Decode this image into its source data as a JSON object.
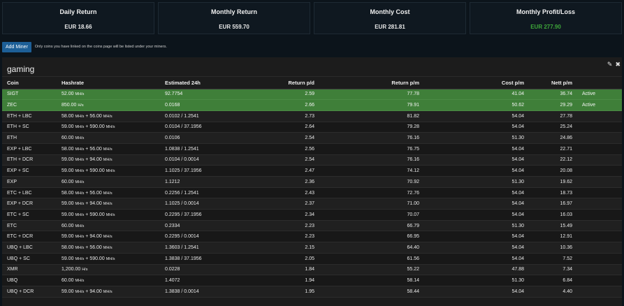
{
  "stats": [
    {
      "title": "Daily Return",
      "value": "EUR 18.66"
    },
    {
      "title": "Monthly Return",
      "value": "EUR 559.70"
    },
    {
      "title": "Monthly Cost",
      "value": "EUR 281.81"
    },
    {
      "title": "Monthly Profit/Loss",
      "value": "EUR 277.90"
    }
  ],
  "colors": {
    "positive": "#3ea83a",
    "active_row": "#3f7f39",
    "button": "#1d5f97"
  },
  "add_miner": {
    "label": "Add Miner",
    "note": "Only coins you have linked on the coins page will be listed under your miners."
  },
  "panel": {
    "title": "gaming",
    "edit_icon": "pencil-icon",
    "close_icon": "close-icon"
  },
  "table": {
    "headers": [
      "Coin",
      "Hashrate",
      "Estimated 24h",
      "Return p/d",
      "Return p/m",
      "Cost p/m",
      "Nett p/m",
      ""
    ],
    "rows": [
      {
        "coin": "SIGT",
        "hash": "52.00",
        "unit": "MH/s",
        "hash2": "",
        "unit2": "",
        "est": "92.7754",
        "rpd": "2.59",
        "rpm": "77.78",
        "cost": "41.04",
        "nett": "36.74",
        "status": "Active"
      },
      {
        "coin": "ZEC",
        "hash": "850.00",
        "unit": "H/s",
        "hash2": "",
        "unit2": "",
        "est": "0.0168",
        "rpd": "2.66",
        "rpm": "79.91",
        "cost": "50.62",
        "nett": "29.29",
        "status": "Active"
      },
      {
        "coin": "ETH + LBC",
        "hash": "58.00",
        "unit": "MH/s",
        "hash2": "56.00",
        "unit2": "MH/s",
        "est": "0.0102 / 1.2541",
        "rpd": "2.73",
        "rpm": "81.82",
        "cost": "54.04",
        "nett": "27.78",
        "status": ""
      },
      {
        "coin": "ETH + SC",
        "hash": "59.00",
        "unit": "MH/s",
        "hash2": "590.00",
        "unit2": "MH/s",
        "est": "0.0104 / 37.1956",
        "rpd": "2.64",
        "rpm": "79.28",
        "cost": "54.04",
        "nett": "25.24",
        "status": ""
      },
      {
        "coin": "ETH",
        "hash": "60.00",
        "unit": "MH/s",
        "hash2": "",
        "unit2": "",
        "est": "0.0106",
        "rpd": "2.54",
        "rpm": "76.16",
        "cost": "51.30",
        "nett": "24.86",
        "status": ""
      },
      {
        "coin": "EXP + LBC",
        "hash": "58.00",
        "unit": "MH/s",
        "hash2": "56.00",
        "unit2": "MH/s",
        "est": "1.0838 / 1.2541",
        "rpd": "2.56",
        "rpm": "76.75",
        "cost": "54.04",
        "nett": "22.71",
        "status": ""
      },
      {
        "coin": "ETH + DCR",
        "hash": "59.00",
        "unit": "MH/s",
        "hash2": "94.00",
        "unit2": "MH/s",
        "est": "0.0104 / 0.0014",
        "rpd": "2.54",
        "rpm": "76.16",
        "cost": "54.04",
        "nett": "22.12",
        "status": ""
      },
      {
        "coin": "EXP + SC",
        "hash": "59.00",
        "unit": "MH/s",
        "hash2": "590.00",
        "unit2": "MH/s",
        "est": "1.1025 / 37.1956",
        "rpd": "2.47",
        "rpm": "74.12",
        "cost": "54.04",
        "nett": "20.08",
        "status": ""
      },
      {
        "coin": "EXP",
        "hash": "60.00",
        "unit": "MH/s",
        "hash2": "",
        "unit2": "",
        "est": "1.1212",
        "rpd": "2.36",
        "rpm": "70.92",
        "cost": "51.30",
        "nett": "19.62",
        "status": ""
      },
      {
        "coin": "ETC + LBC",
        "hash": "58.00",
        "unit": "MH/s",
        "hash2": "56.00",
        "unit2": "MH/s",
        "est": "0.2256 / 1.2541",
        "rpd": "2.43",
        "rpm": "72.76",
        "cost": "54.04",
        "nett": "18.73",
        "status": ""
      },
      {
        "coin": "EXP + DCR",
        "hash": "59.00",
        "unit": "MH/s",
        "hash2": "94.00",
        "unit2": "MH/s",
        "est": "1.1025 / 0.0014",
        "rpd": "2.37",
        "rpm": "71.00",
        "cost": "54.04",
        "nett": "16.97",
        "status": ""
      },
      {
        "coin": "ETC + SC",
        "hash": "59.00",
        "unit": "MH/s",
        "hash2": "590.00",
        "unit2": "MH/s",
        "est": "0.2295 / 37.1956",
        "rpd": "2.34",
        "rpm": "70.07",
        "cost": "54.04",
        "nett": "16.03",
        "status": ""
      },
      {
        "coin": "ETC",
        "hash": "60.00",
        "unit": "MH/s",
        "hash2": "",
        "unit2": "",
        "est": "0.2334",
        "rpd": "2.23",
        "rpm": "66.79",
        "cost": "51.30",
        "nett": "15.49",
        "status": ""
      },
      {
        "coin": "ETC + DCR",
        "hash": "59.00",
        "unit": "MH/s",
        "hash2": "94.00",
        "unit2": "MH/s",
        "est": "0.2295 / 0.0014",
        "rpd": "2.23",
        "rpm": "66.95",
        "cost": "54.04",
        "nett": "12.91",
        "status": ""
      },
      {
        "coin": "UBQ + LBC",
        "hash": "58.00",
        "unit": "MH/s",
        "hash2": "56.00",
        "unit2": "MH/s",
        "est": "1.3603 / 1.2541",
        "rpd": "2.15",
        "rpm": "64.40",
        "cost": "54.04",
        "nett": "10.36",
        "status": ""
      },
      {
        "coin": "UBQ + SC",
        "hash": "59.00",
        "unit": "MH/s",
        "hash2": "590.00",
        "unit2": "MH/s",
        "est": "1.3838 / 37.1956",
        "rpd": "2.05",
        "rpm": "61.56",
        "cost": "54.04",
        "nett": "7.52",
        "status": ""
      },
      {
        "coin": "XMR",
        "hash": "1,200.00",
        "unit": "H/s",
        "hash2": "",
        "unit2": "",
        "est": "0.0228",
        "rpd": "1.84",
        "rpm": "55.22",
        "cost": "47.88",
        "nett": "7.34",
        "status": ""
      },
      {
        "coin": "UBQ",
        "hash": "60.00",
        "unit": "MH/s",
        "hash2": "",
        "unit2": "",
        "est": "1.4072",
        "rpd": "1.94",
        "rpm": "58.14",
        "cost": "51.30",
        "nett": "6.84",
        "status": ""
      },
      {
        "coin": "UBQ + DCR",
        "hash": "59.00",
        "unit": "MH/s",
        "hash2": "94.00",
        "unit2": "MH/s",
        "est": "1.3838 / 0.0014",
        "rpd": "1.95",
        "rpm": "58.44",
        "cost": "54.04",
        "nett": "4.40",
        "status": ""
      }
    ]
  }
}
